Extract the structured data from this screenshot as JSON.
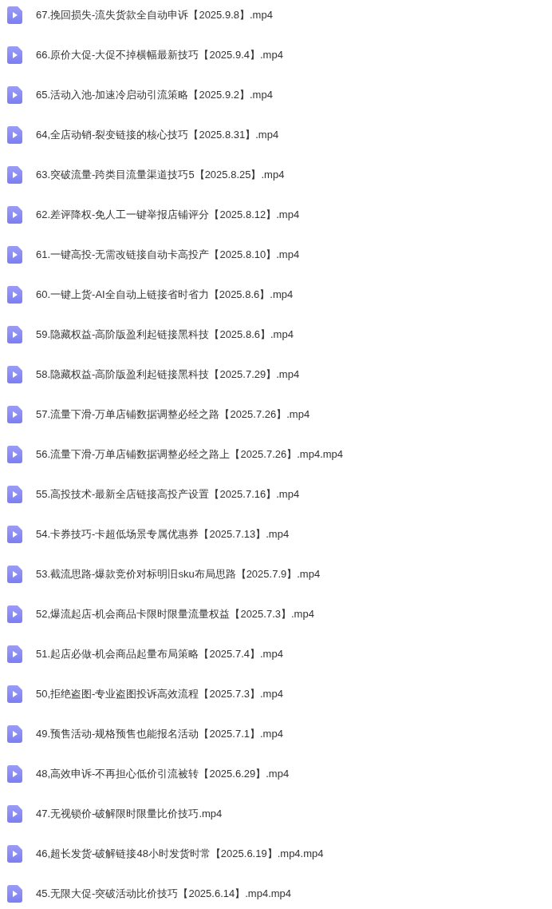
{
  "files": [
    {
      "name": "67.挽回损失-流失货款全自动申诉【2025.9.8】.mp4"
    },
    {
      "name": "66.原价大促-大促不掉横幅最新技巧【2025.9.4】.mp4"
    },
    {
      "name": "65.活动入池-加速冷启动引流策略【2025.9.2】.mp4"
    },
    {
      "name": "64,全店动销-裂变链接的核心技巧【2025.8.31】.mp4"
    },
    {
      "name": "63.突破流量-跨类目流量渠道技巧5【2025.8.25】.mp4"
    },
    {
      "name": "62.差评降权-免人工一键举报店铺评分【2025.8.12】.mp4"
    },
    {
      "name": "61.一键高投-无需改链接自动卡高投产【2025.8.10】.mp4"
    },
    {
      "name": "60.一键上货-AI全自动上链接省时省力【2025.8.6】.mp4"
    },
    {
      "name": "59.隐藏权益-高阶版盈利起链接黑科技【2025.8.6】.mp4"
    },
    {
      "name": "58.隐藏权益-高阶版盈利起链接黑科技【2025.7.29】.mp4"
    },
    {
      "name": "57.流量下滑-万单店铺数据调整必经之路【2025.7.26】.mp4"
    },
    {
      "name": "56.流量下滑-万单店铺数据调整必经之路上【2025.7.26】.mp4.mp4"
    },
    {
      "name": "55.高投技术-最新全店链接高投产设置【2025.7.16】.mp4"
    },
    {
      "name": "54.卡券技巧-卡超低场景专属优惠券【2025.7.13】.mp4"
    },
    {
      "name": "53.截流思路-爆款竞价对标明旧sku布局思路【2025.7.9】.mp4"
    },
    {
      "name": "52,爆流起店-机会商品卡限时限量流量权益【2025.7.3】.mp4"
    },
    {
      "name": "51.起店必做-机会商品起量布局策略【2025.7.4】.mp4"
    },
    {
      "name": "50,拒绝盗图-专业盗图投诉高效流程【2025.7.3】.mp4"
    },
    {
      "name": "49.预售活动-规格预售也能报名活动【2025.7.1】.mp4"
    },
    {
      "name": "48,高效申诉-不再担心低价引流被转【2025.6.29】.mp4"
    },
    {
      "name": "47.无视锁价-破解限时限量比价技巧.mp4"
    },
    {
      "name": "46,超长发货-破解链接48小时发货时常【2025.6.19】.mp4.mp4"
    },
    {
      "name": "45.无限大促-突破活动比价技巧【2025.6.14】.mp4.mp4"
    }
  ]
}
